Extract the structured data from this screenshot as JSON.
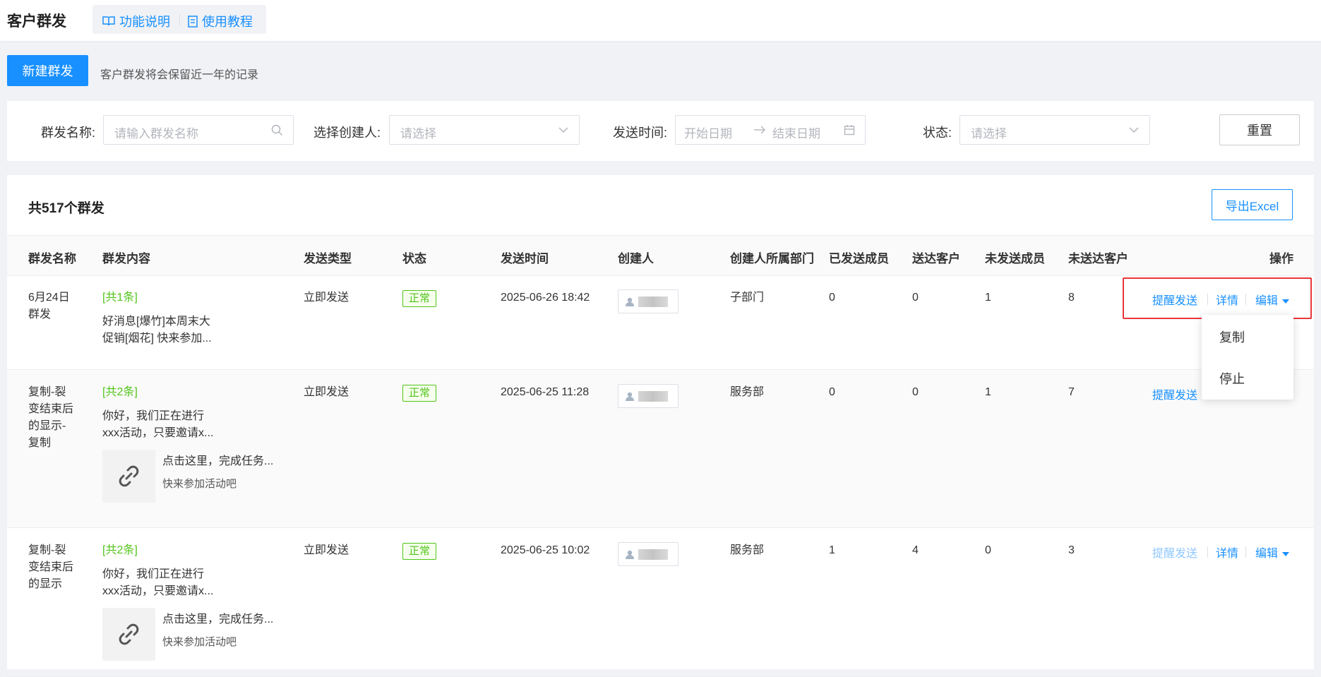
{
  "header": {
    "title": "客户群发",
    "help_links": [
      "功能说明",
      "使用教程"
    ]
  },
  "toolbar": {
    "new_button": "新建群发",
    "tip": "客户群发将会保留近一年的记录"
  },
  "filters": {
    "name_label": "群发名称:",
    "name_placeholder": "请输入群发名称",
    "creator_label": "选择创建人:",
    "creator_placeholder": "请选择",
    "time_label": "发送时间:",
    "start_placeholder": "开始日期",
    "end_placeholder": "结束日期",
    "status_label": "状态:",
    "status_placeholder": "请选择",
    "reset_button": "重置"
  },
  "panel": {
    "count_text": "共517个群发",
    "export_button": "导出Excel"
  },
  "table": {
    "columns": [
      "群发名称",
      "群发内容",
      "发送类型",
      "状态",
      "发送时间",
      "创建人",
      "创建人所属部门",
      "已发送成员",
      "送达客户",
      "未发送成员",
      "未送达客户",
      "操作"
    ],
    "actions": {
      "remind": "提醒发送",
      "detail": "详情",
      "edit": "编辑"
    },
    "rows": [
      {
        "name_lines": [
          "6月24日",
          "群发"
        ],
        "count": "[共1条]",
        "content_lines": [
          "好消息[爆竹]本周末大",
          "促销[烟花] 快来参加..."
        ],
        "send_type": "立即发送",
        "status": "正常",
        "time": "2025-06-26 18:42",
        "dept": "子部门",
        "sent_members": "0",
        "reached": "0",
        "unsent_members": "1",
        "unreached": "8"
      },
      {
        "name_lines": [
          "复制-裂",
          "变结束后",
          "的显示-",
          "复制"
        ],
        "count": "[共2条]",
        "content_lines": [
          "你好，我们正在进行",
          "xxx活动，只要邀请x..."
        ],
        "card_title": "点击这里，完成任务...",
        "card_desc": "快来参加活动吧",
        "send_type": "立即发送",
        "status": "正常",
        "time": "2025-06-25 11:28",
        "dept": "服务部",
        "sent_members": "0",
        "reached": "0",
        "unsent_members": "1",
        "unreached": "7"
      },
      {
        "name_lines": [
          "复制-裂",
          "变结束后",
          "的显示"
        ],
        "count": "[共2条]",
        "content_lines": [
          "你好，我们正在进行",
          "xxx活动，只要邀请x..."
        ],
        "card_title": "点击这里，完成任务...",
        "card_desc": "快来参加活动吧",
        "send_type": "立即发送",
        "status": "正常",
        "time": "2025-06-25 10:02",
        "dept": "服务部",
        "sent_members": "1",
        "reached": "4",
        "unsent_members": "0",
        "unreached": "3"
      }
    ]
  },
  "dropdown": {
    "items": [
      "复制",
      "停止"
    ]
  },
  "colors": {
    "primary": "#1890ff",
    "success": "#52c41a",
    "highlight": "#e8373b"
  }
}
